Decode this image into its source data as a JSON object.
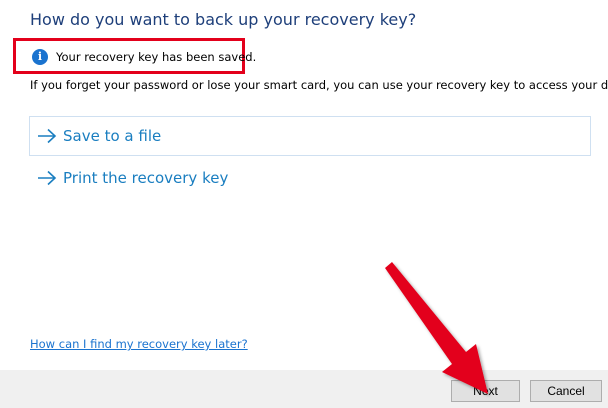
{
  "heading": "How do you want to back up your recovery key?",
  "info": {
    "icon": "info-icon",
    "icon_glyph": "i",
    "text": "Your recovery key has been saved."
  },
  "description": "If you forget your password or lose your smart card, you can use your recovery key to access your drive.",
  "options": [
    {
      "label": "Save to a file",
      "icon": "right-arrow-icon"
    },
    {
      "label": "Print the recovery key",
      "icon": "right-arrow-icon"
    }
  ],
  "help_link": "How can I find my recovery key later?",
  "buttons": {
    "next": "Next",
    "cancel": "Cancel"
  },
  "colors": {
    "heading": "#1e3f7a",
    "option_text": "#1a7ec0",
    "link": "#1a73cf",
    "highlight_box": "#e3001b",
    "annotation_arrow": "#e3001b",
    "footer_bg": "#f0f0f0"
  }
}
